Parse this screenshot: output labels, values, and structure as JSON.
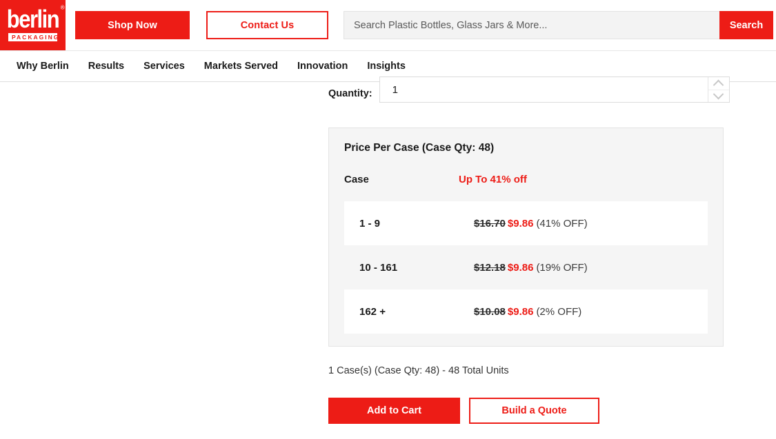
{
  "brand": {
    "logo_word": "berlin",
    "logo_registered": "®",
    "logo_sub": "PACKAGING",
    "accent_color": "#ED1C16"
  },
  "header": {
    "shop_now_label": "Shop Now",
    "contact_us_label": "Contact Us",
    "search": {
      "placeholder": "Search Plastic Bottles, Glass Jars & More...",
      "value": "",
      "button_label": "Search"
    }
  },
  "nav": {
    "items": [
      {
        "label": "Why Berlin"
      },
      {
        "label": "Results"
      },
      {
        "label": "Services"
      },
      {
        "label": "Markets Served"
      },
      {
        "label": "Innovation"
      },
      {
        "label": "Insights"
      }
    ]
  },
  "product": {
    "quantity": {
      "label": "Quantity:",
      "value": "1"
    },
    "pricing": {
      "title": "Price Per Case (Case Qty: 48)",
      "column_header_qty": "Case",
      "column_header_discount": "Up To 41% off",
      "tiers": [
        {
          "range": "1 - 9",
          "list_price": "$16.70",
          "sale_price": "$9.86",
          "discount": "(41% OFF)"
        },
        {
          "range": "10 - 161",
          "list_price": "$12.18",
          "sale_price": "$9.86",
          "discount": "(19% OFF)"
        },
        {
          "range": "162 +",
          "list_price": "$10.08",
          "sale_price": "$9.86",
          "discount": "(2% OFF)"
        }
      ]
    },
    "summary": "1 Case(s) (Case Qty: 48) - 48 Total Units",
    "add_to_cart_label": "Add to Cart",
    "build_quote_label": "Build a Quote"
  }
}
